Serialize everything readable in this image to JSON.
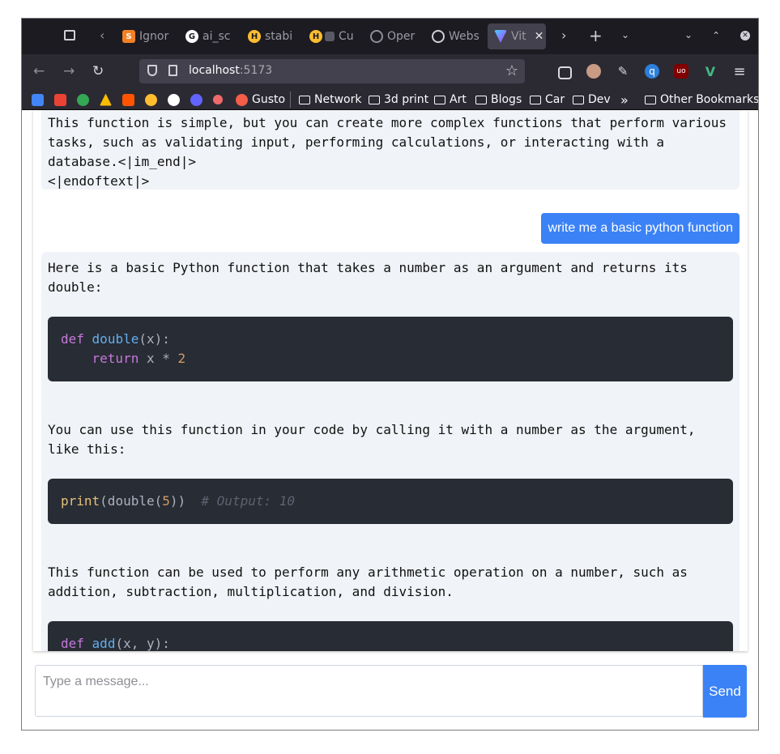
{
  "browser": {
    "tabs": [
      {
        "title": "Ignor",
        "icon": "stackoverflow-icon",
        "color": "#f48024"
      },
      {
        "title": "ai_sc",
        "icon": "github-icon",
        "color": "#ffffff"
      },
      {
        "title": "stabil",
        "icon": "huggingface-icon",
        "color": "#ffbd2e"
      },
      {
        "title": "Cu",
        "icon": "chart-icon",
        "color": "#ffbd2e"
      },
      {
        "title": "Oper",
        "icon": "openai-icon",
        "color": "#8e8e96"
      },
      {
        "title": "Webs",
        "icon": "openai-icon",
        "color": "#cfcfd6"
      },
      {
        "title": "Vit",
        "icon": "vite-icon",
        "color": "#a855f7"
      }
    ],
    "url_host": "localhost",
    "url_port": ":5173",
    "bookmarks": {
      "gusto": "Gusto",
      "folders": [
        "Network",
        "3d print",
        "Art",
        "Blogs",
        "Car",
        "Dev"
      ],
      "other": "Other Bookmarks"
    }
  },
  "chat": {
    "prev_assistant_tail": "This function is simple, but you can create more complex functions that perform various tasks, such as validating input, performing calculations, or interacting with a database.<|im_end|>\n<|endoftext|>",
    "user_message": "write me a basic python function",
    "reply": {
      "intro": "Here is a basic Python function that takes a number as an argument and returns its double:",
      "code1_line1": {
        "kw": "def",
        "fn": "double",
        "rest": "(x):"
      },
      "code1_line2": {
        "kw": "return",
        "rest": " x * ",
        "num": "2"
      },
      "usage": "You can use this function in your code by calling it with a number as the argument, like this:",
      "code2": {
        "bi": "print",
        "a": "(double(",
        "num": "5",
        "b": "))",
        "comment": "# Output: 10"
      },
      "more": "This function can be used to perform any arithmetic operation on a number, such as addition, subtraction, multiplication, and division.",
      "code3_line1": {
        "kw": "def",
        "fn": "add",
        "rest": "(x, y):"
      }
    }
  },
  "composer": {
    "placeholder": "Type a message...",
    "send_label": "Send"
  }
}
